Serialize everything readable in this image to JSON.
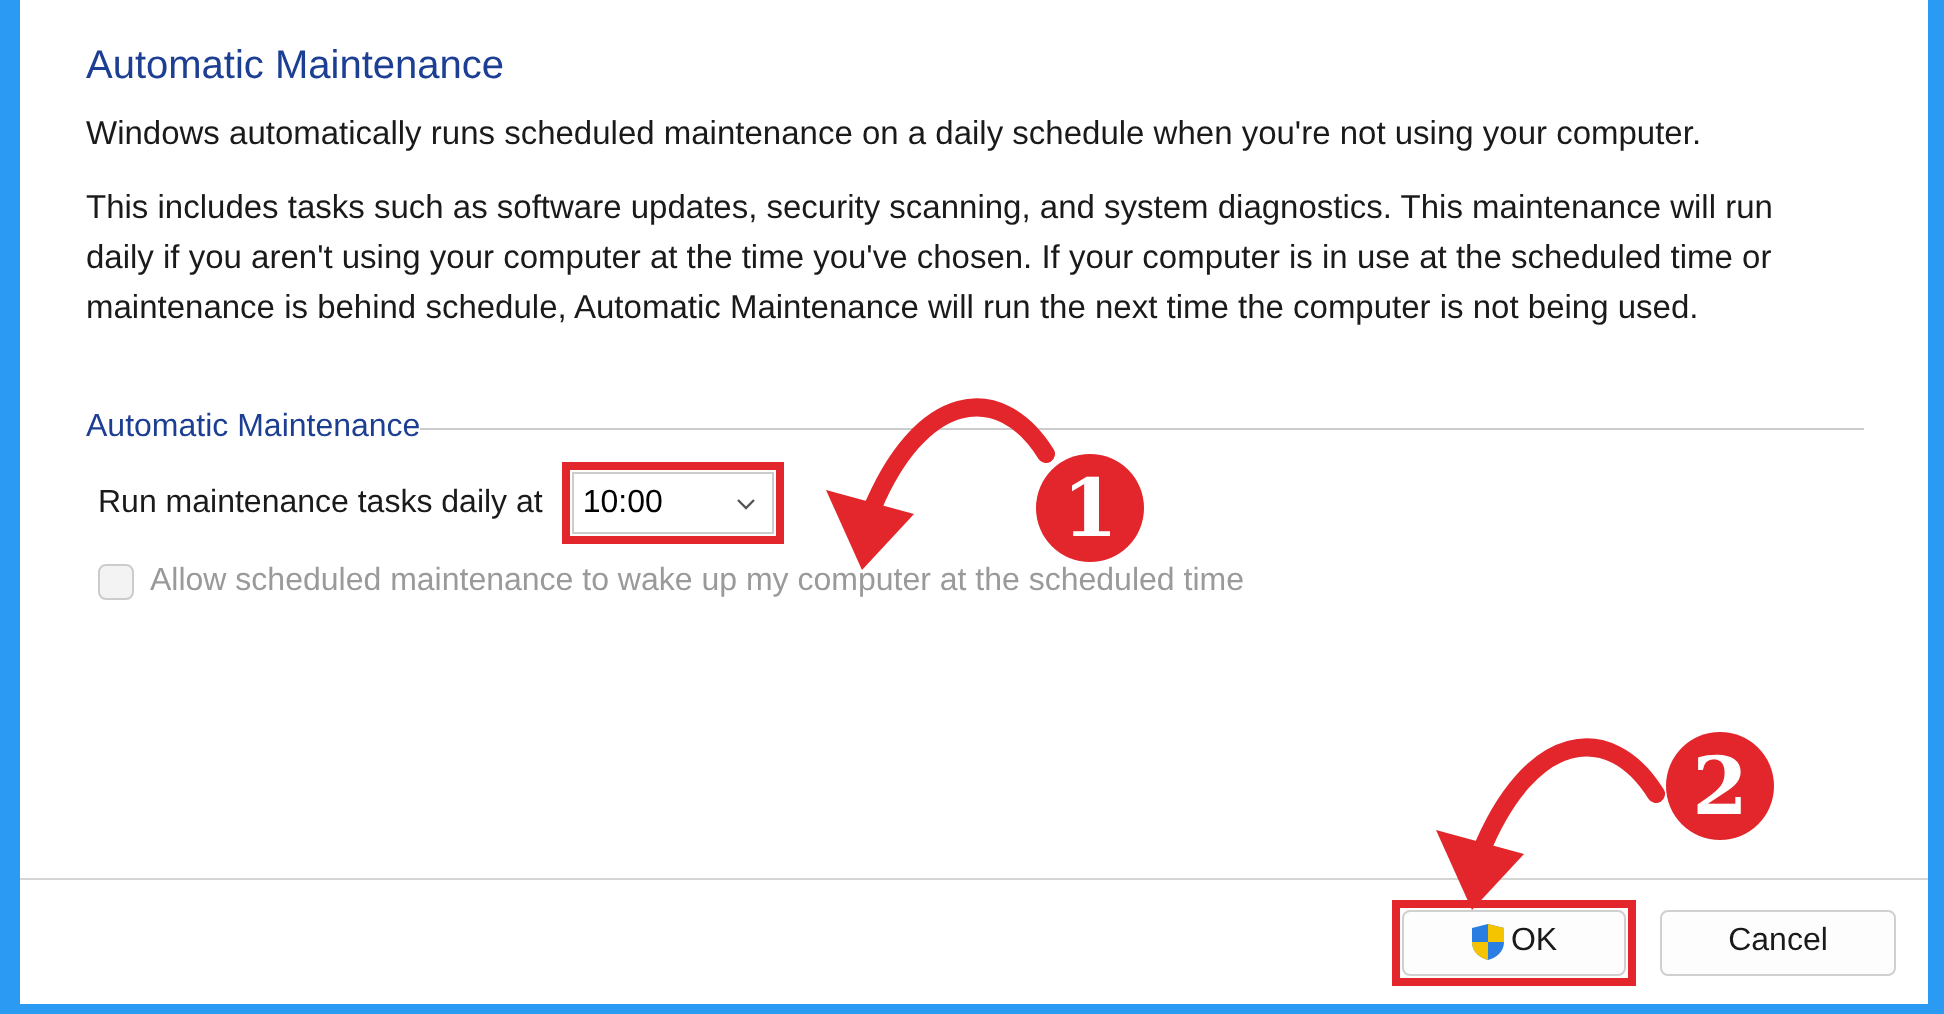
{
  "heading": "Automatic Maintenance",
  "paragraphs": [
    "Windows automatically runs scheduled maintenance on a daily schedule when you're not using your computer.",
    "This includes tasks such as software updates, security scanning, and system diagnostics. This maintenance will run daily if you aren't using your computer at the time you've chosen. If your computer is in use at the scheduled time or maintenance is behind schedule, Automatic Maintenance will run the next time the computer is not being used."
  ],
  "group": {
    "title": "Automatic Maintenance",
    "time_label": "Run maintenance tasks daily at",
    "time_value": "10:00",
    "wake_option": {
      "label": "Allow scheduled maintenance to wake up my computer at the scheduled time",
      "checked": false,
      "disabled": true
    }
  },
  "buttons": [
    {
      "label": "OK",
      "kind": "shield"
    },
    {
      "label": "Cancel",
      "kind": "plain"
    }
  ],
  "annotations": [
    {
      "number": "1"
    },
    {
      "number": "2"
    }
  ]
}
